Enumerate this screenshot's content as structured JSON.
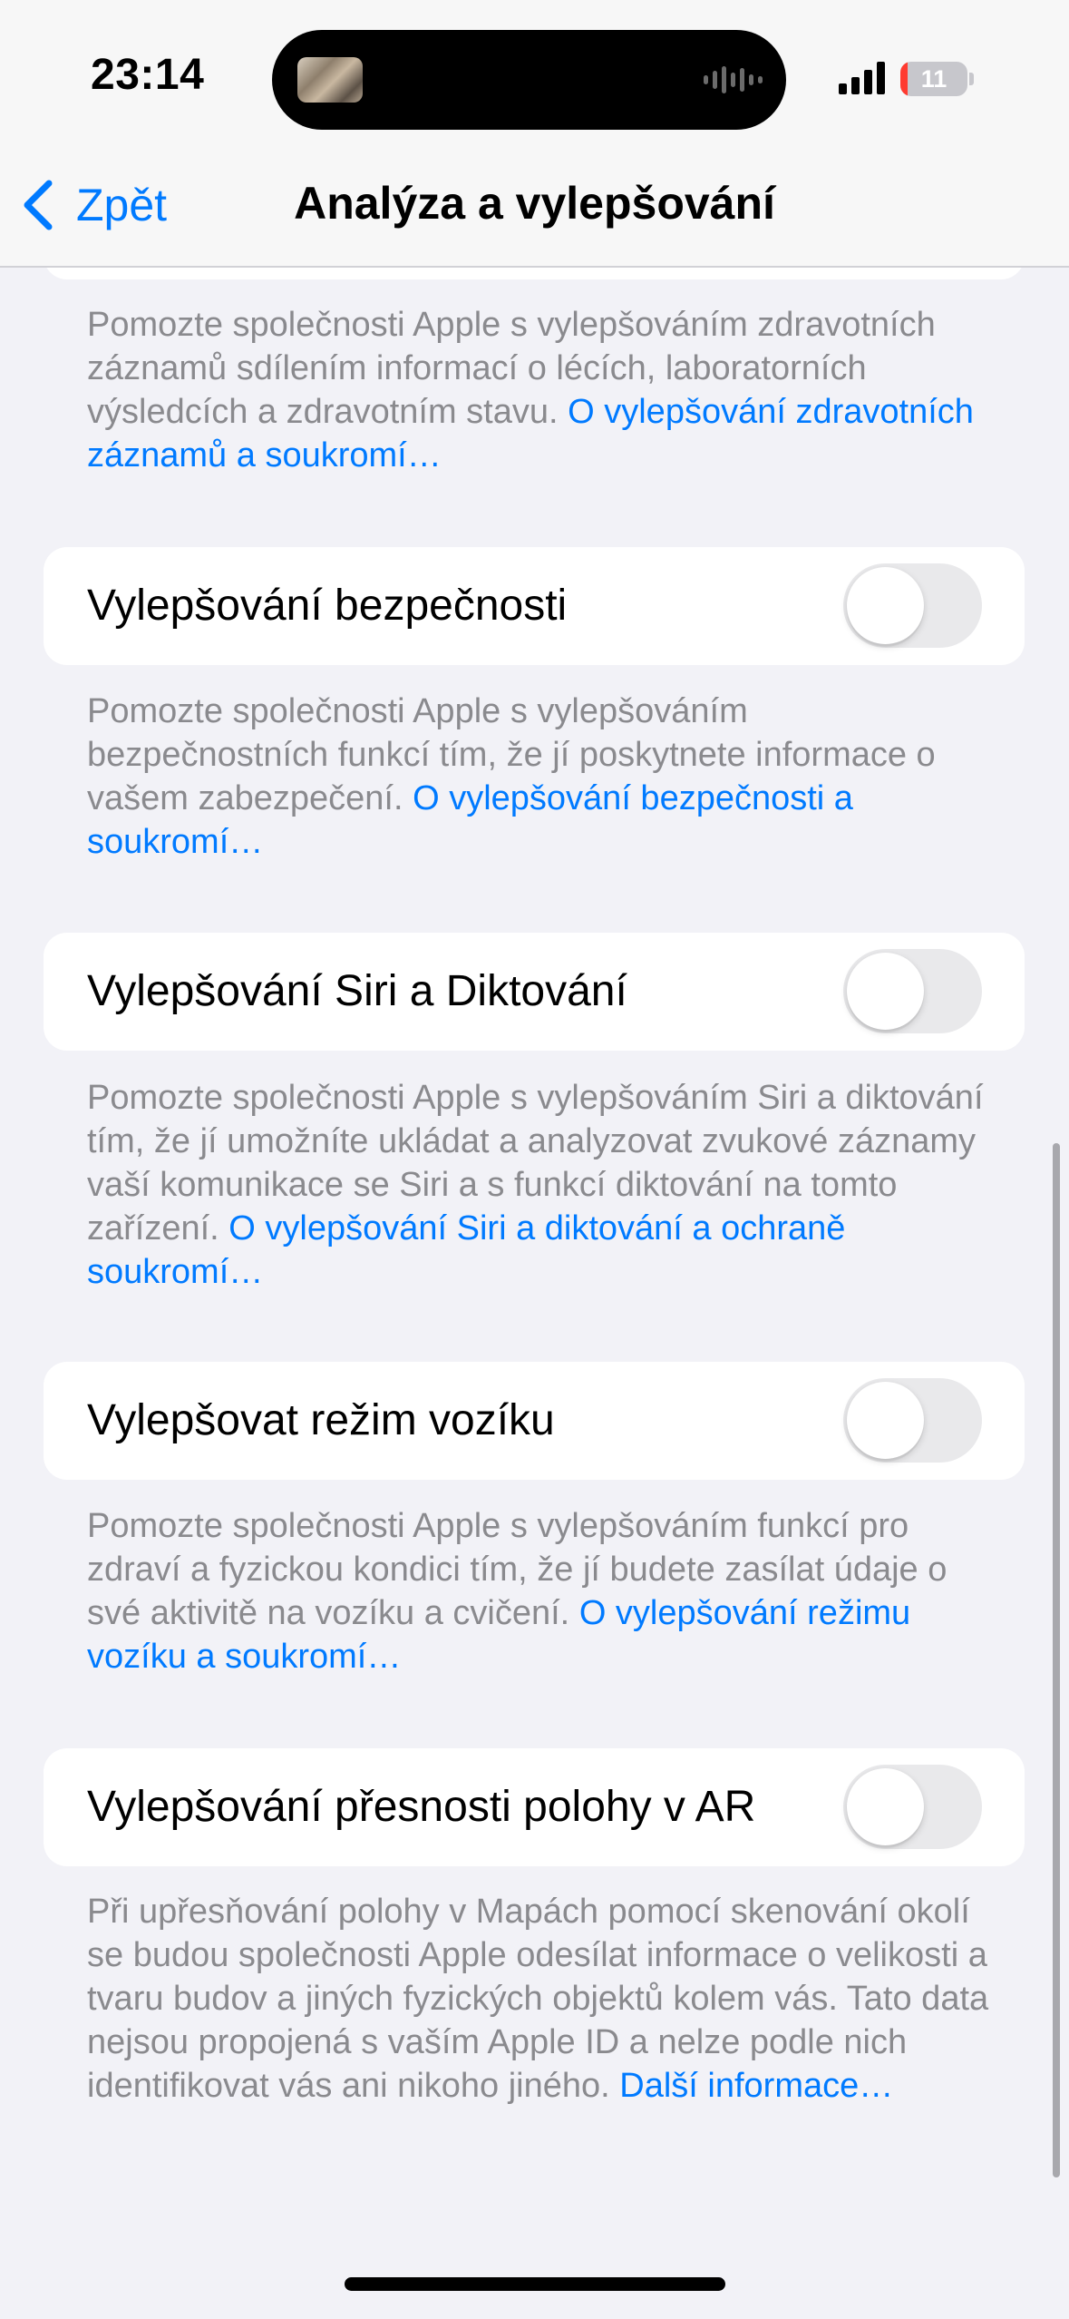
{
  "status_bar": {
    "time": "23:14",
    "battery_level": "11",
    "battery_color": "#ff3b30"
  },
  "nav": {
    "back_label": "Zpět",
    "back_icon": "chevron-left-icon",
    "title": "Analýza a vylepšování"
  },
  "colors": {
    "accent": "#007aff",
    "background": "#f2f2f7",
    "toggle_off": "#e9e9eb",
    "secondary_text": "#8a8a8e"
  },
  "health_records": {
    "footer_text": "Pomozte společnosti Apple s vylepšováním zdravotních záznamů sdílením informací o lécích, laboratorních výsledcích a zdravotním stavu.",
    "footer_link": "O vylepšování zdravotních záznamů a soukromí…"
  },
  "safety": {
    "label": "Vylepšování bezpečnosti",
    "enabled": false,
    "footer_text": "Pomozte společnosti Apple s vylepšováním bezpečnostních funkcí tím, že jí poskytnete informace o vašem zabezpečení.",
    "footer_link": "O vylepšování bezpečnosti a soukromí…"
  },
  "siri": {
    "label": "Vylepšování Siri a Diktování",
    "enabled": false,
    "footer_text": "Pomozte společnosti Apple s vylepšováním Siri a diktování tím, že jí umožníte ukládat a analyzovat zvukové záznamy vaší komunikace se Siri a s funkcí diktování na tomto zařízení.",
    "footer_link": "O vylepšování Siri a diktování a ochraně soukromí…"
  },
  "wheelchair": {
    "label": "Vylepšovat režim vozíku",
    "enabled": false,
    "footer_text": "Pomozte společnosti Apple s vylepšováním funkcí pro zdraví a fyzickou kondici tím, že jí budete zasílat údaje o své aktivitě na vozíku a cvičení.",
    "footer_link": "O vylepšování režimu vozíku a soukromí…"
  },
  "ar_location": {
    "label": "Vylepšování přesnosti polohy v AR",
    "enabled": false,
    "footer_text": "Při upřesňování polohy v Mapách pomocí skenování okolí se budou společnosti Apple odesílat informace o velikosti a tvaru budov a jiných fyzických objektů kolem vás. Tato data nejsou propojená s vaším Apple ID a nelze podle nich identifikovat vás ani nikoho jiného.",
    "footer_link": "Další informace…"
  }
}
